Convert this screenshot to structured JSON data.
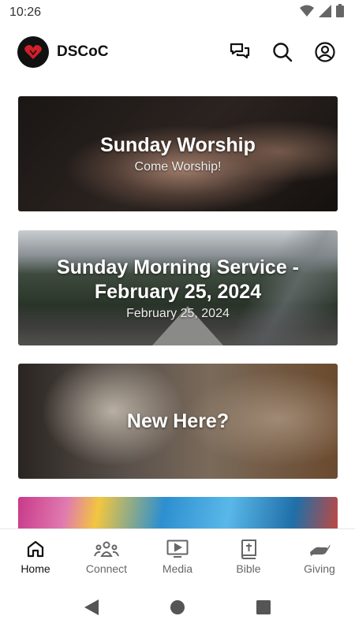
{
  "status_bar": {
    "time": "10:26",
    "icons": [
      "wifi-icon",
      "signal-icon",
      "battery-icon"
    ]
  },
  "app_bar": {
    "title": "DSCoC",
    "logo_icon": "heart-logo-icon",
    "actions": [
      "chat-icon",
      "search-icon",
      "account-icon"
    ]
  },
  "cards": [
    {
      "title": "Sunday Worship",
      "subtitle": "Come Worship!"
    },
    {
      "title": "Sunday Morning Service - February 25, 2024",
      "subtitle": "February 25, 2024"
    },
    {
      "title": "New Here?",
      "subtitle": ""
    },
    {
      "title": "",
      "subtitle": ""
    }
  ],
  "bottom_nav": {
    "items": [
      {
        "label": "Home",
        "icon": "home-icon",
        "active": true
      },
      {
        "label": "Connect",
        "icon": "group-icon",
        "active": false
      },
      {
        "label": "Media",
        "icon": "play-icon",
        "active": false
      },
      {
        "label": "Bible",
        "icon": "bible-icon",
        "active": false
      },
      {
        "label": "Giving",
        "icon": "giving-icon",
        "active": false
      }
    ]
  },
  "system_nav": [
    "back-icon",
    "home-circle-icon",
    "recents-icon"
  ],
  "colors": {
    "accent": "#111111",
    "logo_heart": "#d0202a",
    "inactive": "#666666"
  }
}
